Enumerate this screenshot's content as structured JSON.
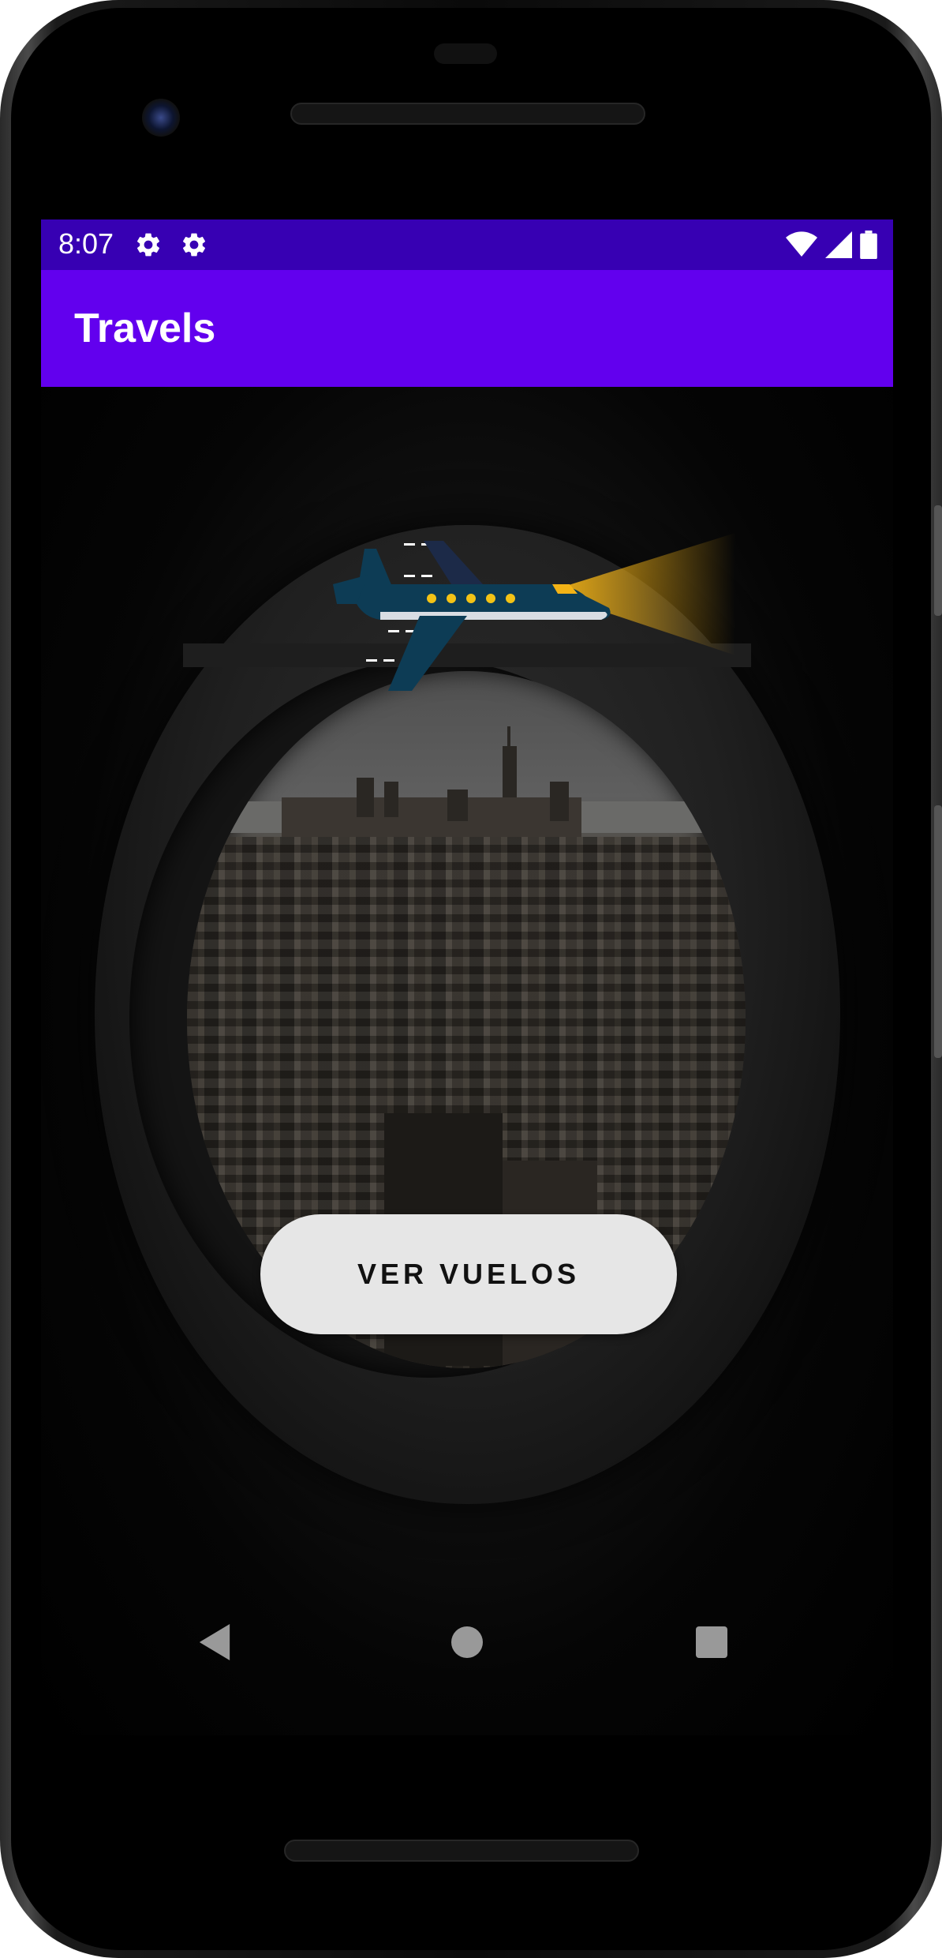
{
  "status_bar": {
    "time": "8:07",
    "icons": [
      "gear-icon",
      "gear-icon",
      "wifi-icon",
      "signal-icon",
      "battery-icon"
    ],
    "color": "#3700b3"
  },
  "app_bar": {
    "title": "Travels",
    "color": "#6200ee"
  },
  "main": {
    "button_label": "VER VUELOS",
    "illustration": "airplane-icon",
    "background": "airplane-window-city-view"
  },
  "nav_bar": {
    "buttons": [
      "back-icon",
      "home-icon",
      "recents-icon"
    ]
  }
}
